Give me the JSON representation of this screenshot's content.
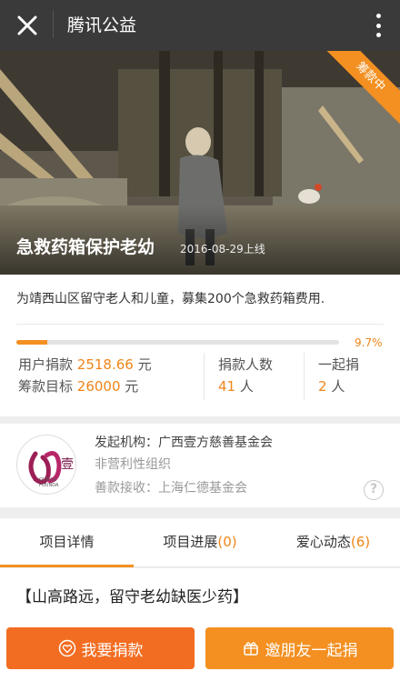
{
  "topbar": {
    "title": "腾讯公益",
    "close_icon": "close-icon",
    "more_icon": "more-vertical-icon"
  },
  "hero": {
    "title": "急救药箱保护老幼",
    "date": "2016-08-29上线",
    "ribbon": "筹款中"
  },
  "summary": {
    "description": "为靖西山区留守老人和儿童，募集200个急救药箱费用.",
    "progress_percent_label": "9.7%",
    "progress_fraction": 0.097,
    "donated_label": "用户捐款",
    "donated_value": "2518.66",
    "donated_unit": "元",
    "target_label": "筹款目标",
    "target_value": "26000",
    "target_unit": "元",
    "donors_label": "捐款人数",
    "donors_value": "41",
    "donors_unit": "人",
    "together_label": "一起捐",
    "together_value": "2",
    "together_unit": "人"
  },
  "org": {
    "initiator": "发起机构：广西壹方慈善基金会",
    "type": "非营利性组织",
    "receiver": "善款接收：上海仁德基金会",
    "logo_text": "OUR-LA FOUNDA",
    "logo_char": "壹"
  },
  "tabs": [
    {
      "label": "项目详情",
      "count": ""
    },
    {
      "label": "项目进展",
      "count": "(0)"
    },
    {
      "label": "爱心动态",
      "count": "(6)"
    }
  ],
  "content": {
    "heading": "【山高路远，留守老幼缺医少药】"
  },
  "actions": {
    "donate": "我要捐款",
    "invite": "邀朋友一起捐"
  },
  "colors": {
    "accent": "#f39021",
    "accent_dark": "#f26d21",
    "topbar": "#3a3a3a"
  }
}
